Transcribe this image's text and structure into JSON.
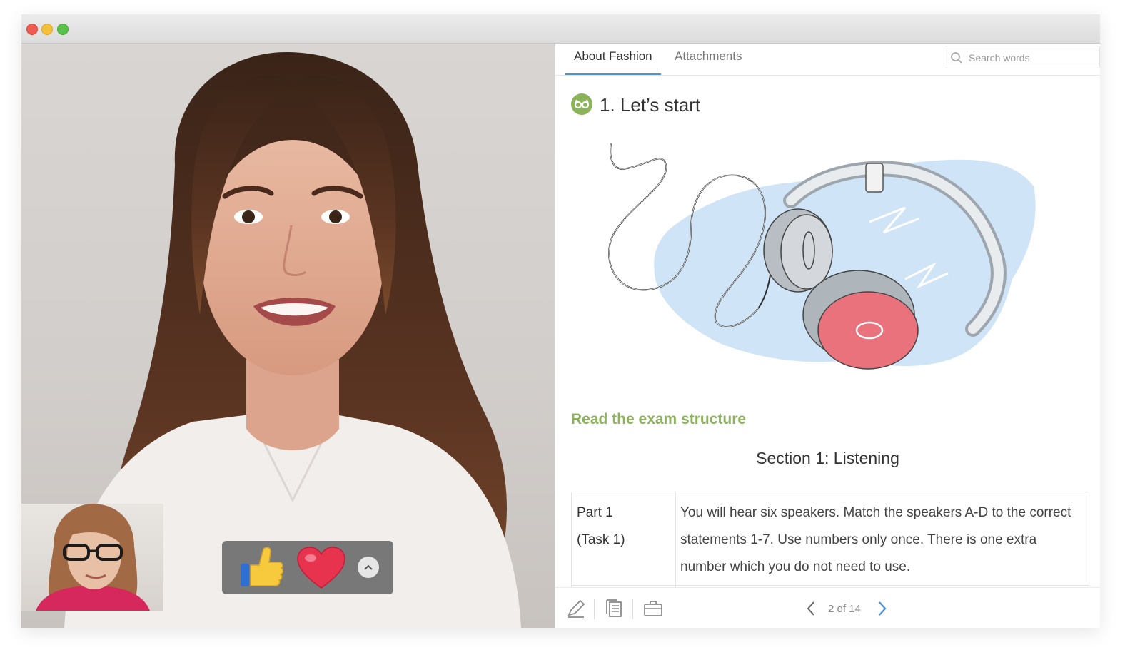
{
  "window": {
    "controls": [
      "close",
      "minimize",
      "zoom"
    ]
  },
  "video_call": {
    "main_video": "video-feed",
    "self_view": "self-view-feed",
    "reactions": {
      "items": [
        {
          "name": "thumbs-up",
          "emoji": "👍"
        },
        {
          "name": "heart",
          "emoji": "❤️"
        }
      ],
      "expand_icon": "chevron-up-icon"
    }
  },
  "lesson_panel": {
    "tabs": [
      {
        "label": "About Fashion",
        "active": true
      },
      {
        "label": "Attachments",
        "active": false
      }
    ],
    "search": {
      "placeholder": "Search words",
      "icon": "search-icon"
    },
    "heading": {
      "icon": "glasses-icon",
      "title": "1. Let’s start"
    },
    "illustration": "headphones-illustration",
    "subheading": "Read the exam structure",
    "section_title": "Section 1: Listening",
    "table": {
      "rows": [
        {
          "part": "Part 1",
          "task": "(Task 1)",
          "description": "You will hear six speakers. Match the speakers A-D to the correct statements 1-7. Use numbers only once. There is one extra number which you do not need to use."
        }
      ]
    },
    "toolbar": {
      "tools": [
        "pencil-icon",
        "notes-icon",
        "briefcase-icon"
      ],
      "pager": {
        "text": "2 of 14",
        "prev_icon": "chevron-left-icon",
        "next_icon": "chevron-right-icon"
      }
    }
  },
  "colors": {
    "accent_blue": "#4a90d9",
    "heading_green": "#8db25d",
    "icon_green": "#8bb35a",
    "headphone_pink": "#e9727d",
    "splash_blue": "#cfe4f6"
  }
}
